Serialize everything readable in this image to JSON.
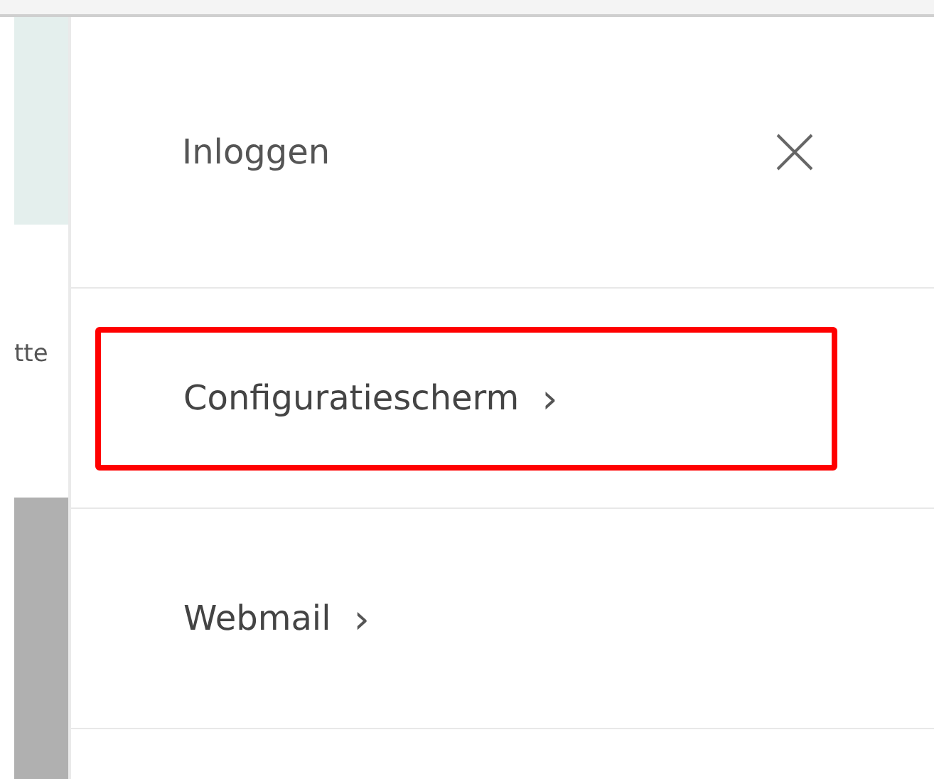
{
  "background": {
    "cut_text": "tte"
  },
  "panel": {
    "title": "Inloggen",
    "items": [
      {
        "label": "Configuratiescherm",
        "chevron": "›",
        "highlighted": true
      },
      {
        "label": "Webmail",
        "chevron": "›",
        "highlighted": false
      }
    ]
  }
}
